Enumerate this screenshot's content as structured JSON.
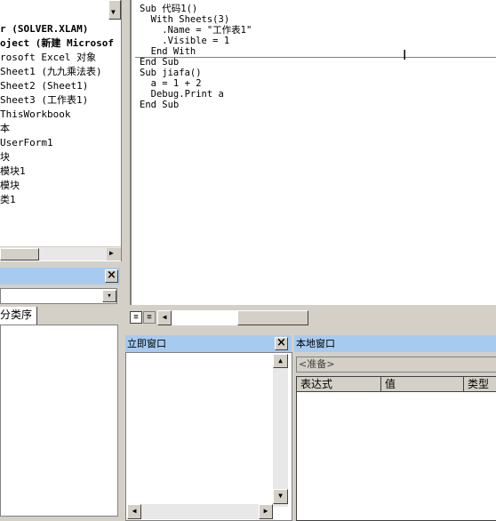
{
  "project_explorer": {
    "tree": [
      "r (SOLVER.XLAM)",
      "oject (新建 Microsof",
      "rosoft Excel 对象",
      "Sheet1 (九九乘法表)",
      "Sheet2 (Sheet1)",
      "Sheet3 (工作表1)",
      "ThisWorkbook",
      "本",
      "UserForm1",
      "块",
      "模块1",
      "模块",
      "类1"
    ]
  },
  "properties": {
    "tab_category": "分类序"
  },
  "code_window": {
    "lines": [
      "Sub 代码1()",
      "  With Sheets(3)",
      "    .Name = \"工作表1\"",
      "    .Visible = 1",
      "  End With",
      "End Sub",
      "Sub jiafa()",
      "  a = 1 + 2",
      "  Debug.Print a",
      "End Sub"
    ]
  },
  "immediate_window": {
    "title": "立即窗口"
  },
  "locals_window": {
    "title": "本地窗口",
    "context": "<准备>",
    "columns": [
      "表达式",
      "值",
      "类型"
    ]
  },
  "icons": {
    "close": "×",
    "arrow_up": "▲",
    "arrow_down": "▼",
    "arrow_left": "◀",
    "arrow_right": "▶",
    "combo_down": "▾",
    "text_cursor": "I"
  }
}
